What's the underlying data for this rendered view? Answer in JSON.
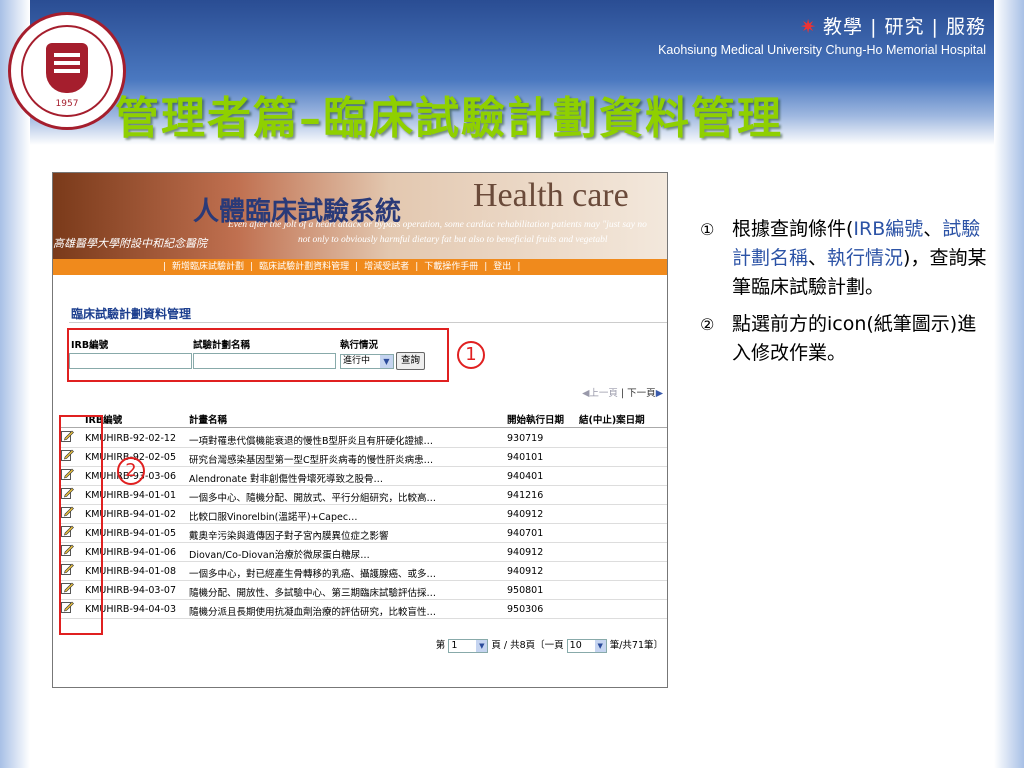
{
  "header": {
    "nav_cn": "教學 | 研究 | 服務",
    "nav_en": "Kaohsiung Medical University  Chung-Ho Memorial Hospital",
    "logo_year": "1957"
  },
  "slide_title": "管理者篇–臨床試驗計劃資料管理",
  "screenshot": {
    "banner": {
      "system_name": "人體臨床試驗系統",
      "health_care": "Health care",
      "university": "高雄醫學大學附設中和紀念醫院",
      "english_line1": "Even after the jolt of a heart attack or bypass operation, some cardiac rehabilitation patients may \"just say no",
      "english_line2": "not only to obviously harmful dietary fat but also to beneficial fruits and vegetabl"
    },
    "navbar": [
      "新增臨床試驗計劃",
      "臨床試驗計劃資料管理",
      "增減受試者",
      "下載操作手冊",
      "登出"
    ],
    "section_title": "臨床試驗計劃資料管理",
    "search": {
      "irb_label": "IRB編號",
      "plan_name_label": "試驗計劃名稱",
      "status_label": "執行情況",
      "status_value": "進行中",
      "query_button": "查詢"
    },
    "pager_top": {
      "prev": "上一頁",
      "next": "下一頁"
    },
    "table": {
      "headers": [
        "IRB編號",
        "計畫名稱",
        "開始執行日期",
        "結(中止)案日期"
      ],
      "rows": [
        {
          "irb": "KMUHIRB-92-02-12",
          "name": "一項對罹患代償機能衰退的慢性B型肝炎且有肝硬化證據…",
          "start": "930719"
        },
        {
          "irb": "KMUHIRB-92-02-05",
          "name": "研究台灣感染基因型第一型C型肝炎病毒的慢性肝炎病患…",
          "start": "940101"
        },
        {
          "irb": "KMUHIRB-93-03-06",
          "name": "Alendronate 對非創傷性骨壞死導致之股骨…",
          "start": "940401"
        },
        {
          "irb": "KMUHIRB-94-01-01",
          "name": "一個多中心、隨機分配、開放式、平行分組研究，比較高…",
          "start": "941216"
        },
        {
          "irb": "KMUHIRB-94-01-02",
          "name": "比較口服Vinorelbin(溫諾平)+Capec…",
          "start": "940912"
        },
        {
          "irb": "KMUHIRB-94-01-05",
          "name": "戴奧辛污染與遺傳因子對子宮內膜異位症之影響",
          "start": "940701"
        },
        {
          "irb": "KMUHIRB-94-01-06",
          "name": "Diovan/Co-Diovan治療於微尿蛋白糖尿…",
          "start": "940912"
        },
        {
          "irb": "KMUHIRB-94-01-08",
          "name": "一個多中心，對已經產生骨轉移的乳癌、攝護腺癌、或多…",
          "start": "940912"
        },
        {
          "irb": "KMUHIRB-94-03-07",
          "name": "隨機分配、開放性、多試驗中心、第三期臨床試驗評估採…",
          "start": "950801"
        },
        {
          "irb": "KMUHIRB-94-04-03",
          "name": "隨機分派且長期使用抗凝血劑治療的評估研究，比較盲性…",
          "start": "950306"
        }
      ]
    },
    "pager_bottom": {
      "page_prefix": "第",
      "page_value": "1",
      "page_suffix": "頁 / 共8頁〔一頁",
      "per_page_value": "10",
      "per_page_suffix": "筆/共71筆〕"
    }
  },
  "markers": {
    "one": "1",
    "two": "2"
  },
  "notes": [
    {
      "num": "①",
      "parts": [
        {
          "text": "根據查詢條件(",
          "hl": false
        },
        {
          "text": "IRB編號",
          "hl": true
        },
        {
          "text": "、",
          "hl": false
        },
        {
          "text": "試驗計劃名稱",
          "hl": true
        },
        {
          "text": "、",
          "hl": false
        },
        {
          "text": "執行情況",
          "hl": true
        },
        {
          "text": ")，查詢某筆臨床試驗計劃。",
          "hl": false
        }
      ]
    },
    {
      "num": "②",
      "parts": [
        {
          "text": "點選前方的icon(紙筆圖示)進入修改作業。",
          "hl": false
        }
      ]
    }
  ],
  "colors": {
    "title_green": "#8fd000",
    "highlight_blue": "#2c53a6",
    "nav_orange": "#f08a1c",
    "annotation_red": "#e02020"
  }
}
